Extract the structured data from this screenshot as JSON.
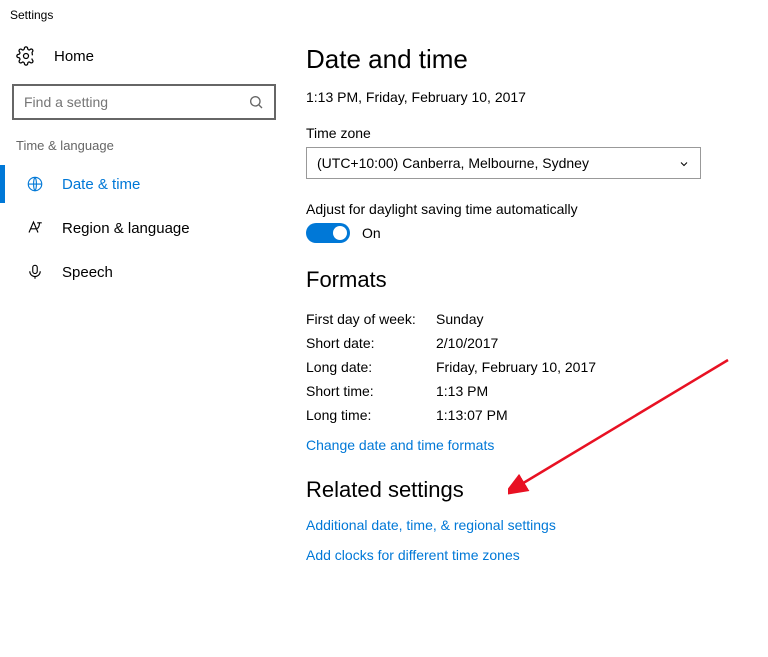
{
  "window_title": "Settings",
  "sidebar": {
    "home_label": "Home",
    "search_placeholder": "Find a setting",
    "section_label": "Time & language",
    "items": [
      {
        "label": "Date & time",
        "icon": "clock-globe-icon",
        "active": true
      },
      {
        "label": "Region & language",
        "icon": "region-language-icon",
        "active": false
      },
      {
        "label": "Speech",
        "icon": "microphone-icon",
        "active": false
      }
    ]
  },
  "main": {
    "heading": "Date and time",
    "current_time": "1:13 PM, Friday, February 10, 2017",
    "timezone_label": "Time zone",
    "timezone_value": "(UTC+10:00) Canberra, Melbourne, Sydney",
    "dst_label": "Adjust for daylight saving time automatically",
    "dst_state": "On",
    "formats_heading": "Formats",
    "formats": [
      {
        "k": "First day of week:",
        "v": "Sunday"
      },
      {
        "k": "Short date:",
        "v": "2/10/2017"
      },
      {
        "k": "Long date:",
        "v": "Friday, February 10, 2017"
      },
      {
        "k": "Short time:",
        "v": "1:13 PM"
      },
      {
        "k": "Long time:",
        "v": "1:13:07 PM"
      }
    ],
    "change_formats_link": "Change date and time formats",
    "related_heading": "Related settings",
    "related_links": [
      "Additional date, time, & regional settings",
      "Add clocks for different time zones"
    ]
  }
}
